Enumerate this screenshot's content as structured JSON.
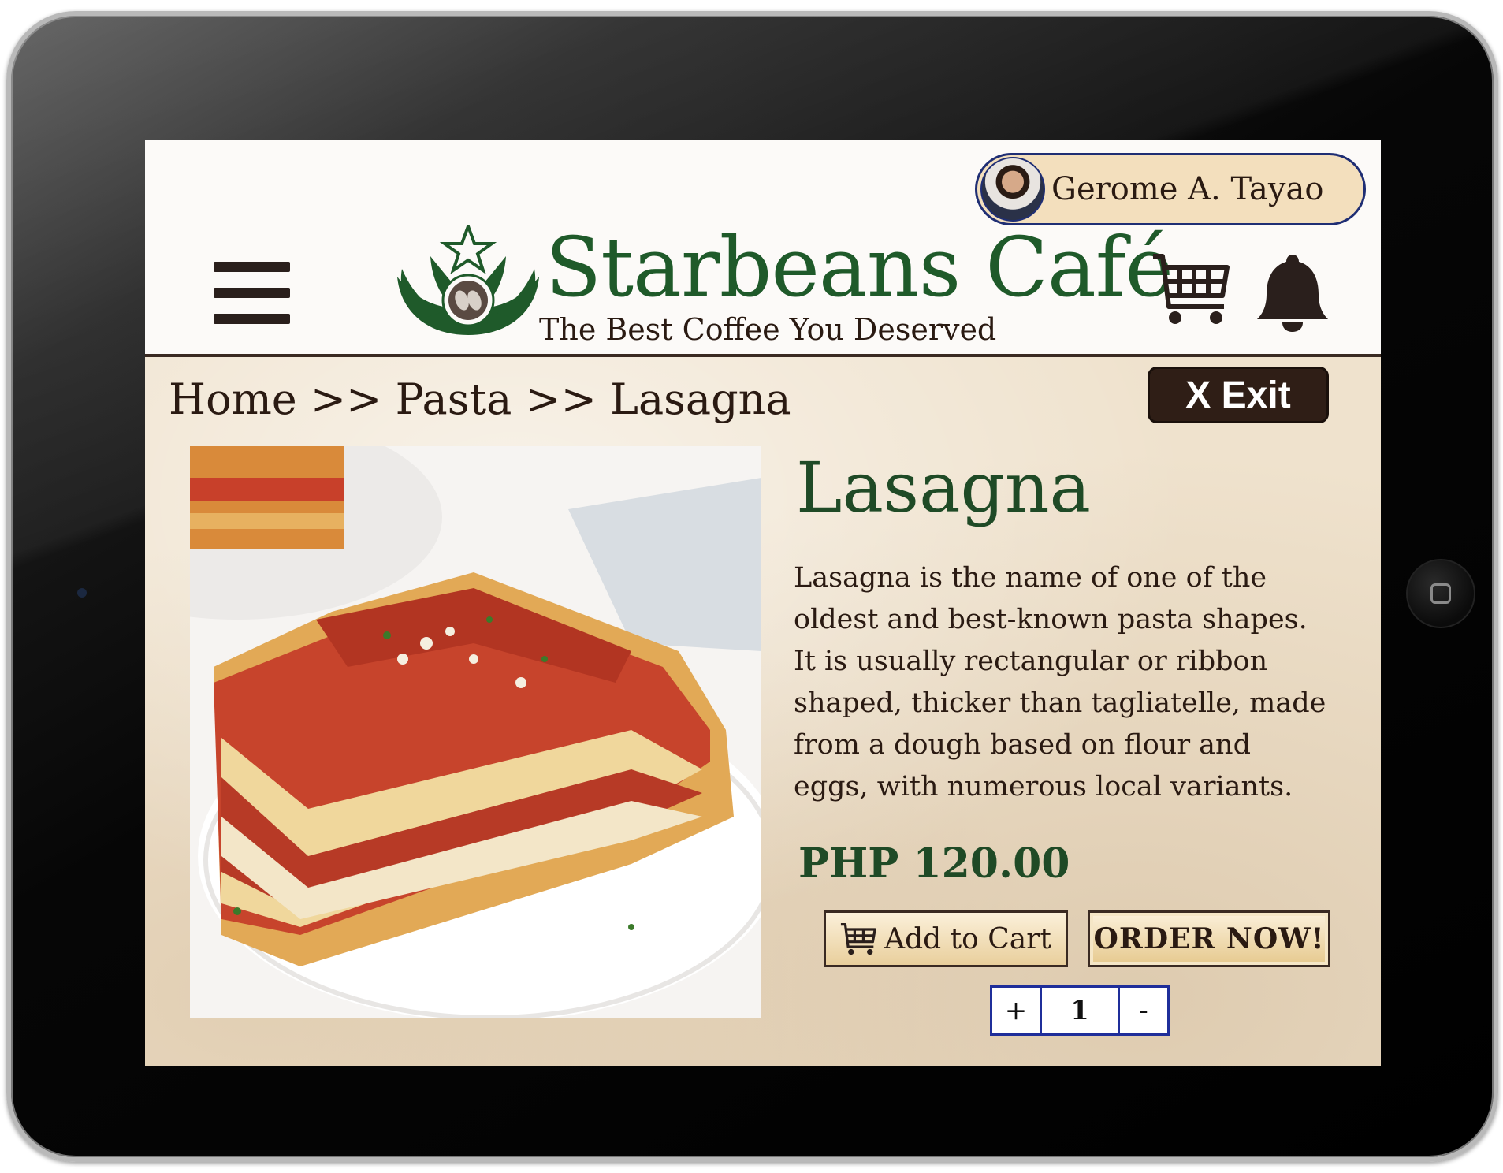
{
  "user": {
    "name": "Gerome A. Tayao"
  },
  "brand": {
    "title": "Starbeans Café",
    "tagline": "The Best Coffee You Deserved",
    "color": "#1f5a2a"
  },
  "header": {
    "menu_icon": "hamburger-menu-icon",
    "cart_icon": "shopping-cart-icon",
    "bell_icon": "notification-bell-icon"
  },
  "breadcrumb": {
    "text": "Home >> Pasta >> Lasagna"
  },
  "exit_button": {
    "label": "X Exit"
  },
  "product": {
    "title": "Lasagna",
    "description": "Lasagna is the name of one of the oldest and best-known pasta shapes. It is usually rectangular or ribbon shaped, thicker than tagliatelle, made from a dough based on flour and eggs, with numerous local variants.",
    "price": "PHP 120.00",
    "image_alt": "lasagna-photo"
  },
  "actions": {
    "add_to_cart": "Add to Cart",
    "order_now": "ORDER NOW!"
  },
  "quantity": {
    "plus": "+",
    "value": "1",
    "minus": "-"
  }
}
